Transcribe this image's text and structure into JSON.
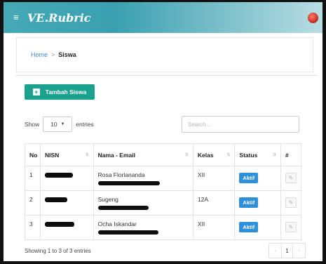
{
  "app": {
    "brand": "VE.Rubric",
    "menu_icon": "hamburger-icon",
    "avatar_icon": "user-avatar"
  },
  "breadcrumb": {
    "home": "Home",
    "separator": ">",
    "current": "Siswa"
  },
  "toolbar": {
    "add_label": "Tambah Siswa",
    "add_icon": "plus-square-icon",
    "accent_color": "#1aa28f"
  },
  "table_controls": {
    "show_label": "Show",
    "entries_value": "10",
    "entries_label": "entries",
    "search_placeholder": "Search..."
  },
  "table": {
    "headers": [
      "No",
      "NISN",
      "Nama - Email",
      "Kelas",
      "Status",
      "#"
    ],
    "rows": [
      {
        "no": "1",
        "nama": "Rosa Florlananda",
        "kelas": "XII",
        "status": "Aktif"
      },
      {
        "no": "2",
        "nama": "Sugeng",
        "kelas": "12A",
        "status": "Aktif"
      },
      {
        "no": "3",
        "nama": "Ocha Iskandar",
        "kelas": "XII",
        "status": "Aktif"
      }
    ],
    "status_color": "#2f8fd8"
  },
  "footer": {
    "info": "Showing 1 to 3 of 3 entries",
    "prev": "‹",
    "page": "1",
    "next": "›"
  }
}
